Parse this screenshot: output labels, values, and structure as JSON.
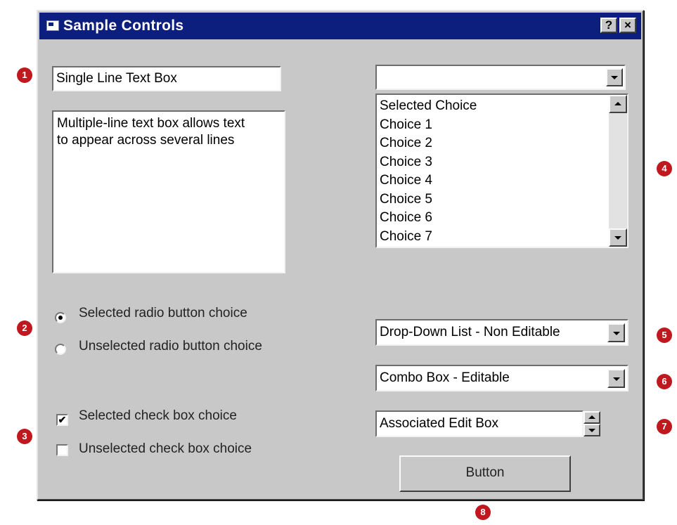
{
  "window": {
    "title": "Sample Controls",
    "help_button": "?",
    "close_button": "×"
  },
  "single_line_textbox": {
    "value": "Single Line Text Box"
  },
  "multi_line_textbox": {
    "lines": [
      "Multiple-line text box allows text",
      "to appear across several lines"
    ]
  },
  "radio_buttons": [
    {
      "label": "Selected radio button choice",
      "selected": true
    },
    {
      "label": "Unselected radio button choice",
      "selected": false
    }
  ],
  "checkboxes": [
    {
      "label": "Selected check box choice",
      "checked": true,
      "mark": "✔"
    },
    {
      "label": "Unselected check box choice",
      "checked": false,
      "mark": ""
    }
  ],
  "list_combo": {
    "value": "",
    "items": [
      "Selected Choice",
      "Choice 1",
      "Choice 2",
      "Choice 3",
      "Choice 4",
      "Choice 5",
      "Choice 6",
      "Choice 7"
    ]
  },
  "dropdown_list": {
    "value": "Drop-Down List - Non Editable"
  },
  "combo_box": {
    "value": "Combo Box - Editable"
  },
  "spin_edit": {
    "value": "Associated Edit Box"
  },
  "button": {
    "label": "Button"
  },
  "callouts": [
    "1",
    "2",
    "3",
    "4",
    "5",
    "6",
    "7",
    "8"
  ],
  "colors": {
    "titlebar": "#0d1f7e",
    "face": "#c8c8c8",
    "callout": "#c0181f"
  }
}
